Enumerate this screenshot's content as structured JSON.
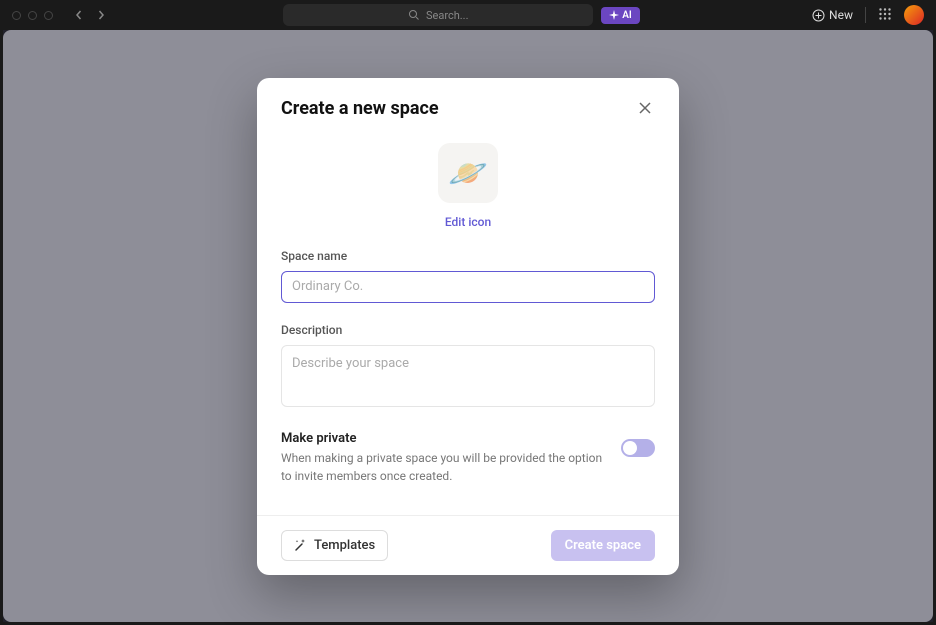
{
  "topbar": {
    "search_placeholder": "Search...",
    "ai_label": "AI",
    "new_label": "New"
  },
  "modal": {
    "title": "Create a new space",
    "icon_emoji": "🪐",
    "edit_icon_label": "Edit icon",
    "space_name_label": "Space name",
    "space_name_placeholder": "Ordinary Co.",
    "space_name_value": "",
    "description_label": "Description",
    "description_placeholder": "Describe your space",
    "description_value": "",
    "privacy_title": "Make private",
    "privacy_description": "When making a private space you will be provided the option to invite members once created.",
    "privacy_toggle_on": false,
    "templates_label": "Templates",
    "create_label": "Create space"
  }
}
